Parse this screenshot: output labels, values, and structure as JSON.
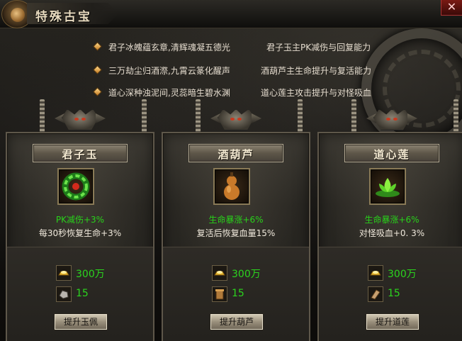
{
  "window": {
    "title": "特殊古宝",
    "close_symbol": "✕"
  },
  "descriptions": [
    {
      "left": "君子冰魄蕴玄章,清辉魂凝五德光",
      "right": "君子玉主PK减伤与回复能力"
    },
    {
      "left": "三万劫尘归酒漈,九霄云篆化醒声",
      "right": "酒葫芦主生命提升与复活能力"
    },
    {
      "left": "道心深种浊泥间,灵蕊暗生碧水渊",
      "right": "道心莲主攻击提升与对怪吸血"
    }
  ],
  "cards": [
    {
      "name": "君子玉",
      "icon": "jade-ring-icon",
      "stat_1": "PK减伤+3%",
      "stat_2": "每30秒恢复生命+3%",
      "gold_cost": "300万",
      "material_count": "15",
      "material_icon": "stone-material-icon",
      "button_label": "提升玉佩"
    },
    {
      "name": "酒葫芦",
      "icon": "gourd-icon",
      "stat_1": "生命暴涨+6%",
      "stat_2": "复活后恢复血量15%",
      "gold_cost": "300万",
      "material_count": "15",
      "material_icon": "scroll-material-icon",
      "button_label": "提升葫芦"
    },
    {
      "name": "道心莲",
      "icon": "lotus-icon",
      "stat_1": "生命暴涨+6%",
      "stat_2": "对怪吸血+0. 3%",
      "gold_cost": "300万",
      "material_count": "15",
      "material_icon": "wood-material-icon",
      "button_label": "提升道莲"
    }
  ],
  "colors": {
    "stat_green": "#28d21a",
    "gold_text": "#2bd41e",
    "title_text": "#e9dcc0"
  }
}
